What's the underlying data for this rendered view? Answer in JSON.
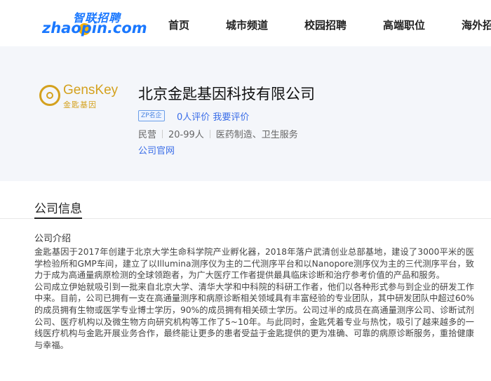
{
  "brand": {
    "logo_cn": "智联招聘",
    "logo_en": "zhaopin.com"
  },
  "nav": [
    "首页",
    "城市频道",
    "校园招聘",
    "高端职位",
    "海外招"
  ],
  "company": {
    "logo_en": "GensKey",
    "logo_cn": "金匙基因",
    "name": "北京金匙基因科技有限公司",
    "badge": "ZP名企",
    "reviews": "0人评价",
    "write_review": "我要评价",
    "ownership": "民营",
    "size": "20-99人",
    "industry": "医药制造、卫生服务",
    "website_label": "公司官网"
  },
  "info": {
    "section_title": "公司信息",
    "intro_title": "公司介绍",
    "paragraphs": [
      "金匙基因于2017年创建于北京大学生命科学院产业孵化器，2018年落户武清创业总部基地，建设了3000平米的医学检验所和GMP车间，建立了以Illumina测序仪为主的二代测序平台和以Nanopore测序仪为主的三代测序平台，致力于成为高通量病原检测的全球领跑者，为广大医疗工作者提供最具临床诊断和治疗参考价值的产品和服务。",
      "公司成立伊始就吸引到一批来自北京大学、清华大学和中科院的科研工作者，他们以各种形式参与到企业的研发工作中来。目前，公司已拥有一支在高通量测序和病原诊断相关领域具有丰富经验的专业团队，其中研发团队中超过60%的成员拥有生物或医学专业博士学历，90%的成员拥有相关硕士学历。公司过半的成员在高通量测序公司、诊断试剂公司、医疗机构以及微生物方向研究机构等工作了5~10年。与此同时，金匙凭着专业与热忱，吸引了越来越多的一线医疗机构与金匙开展业务合作，最终能让更多的患者受益于金匙提供的更为准确、可靠的病原诊断服务，重拾健康与幸福。"
    ]
  },
  "colors": {
    "brand_blue": "#1a78ff",
    "link_blue": "#3b6ee8",
    "gold": "#d4a11e",
    "band_bg": "#f4f6fa"
  }
}
